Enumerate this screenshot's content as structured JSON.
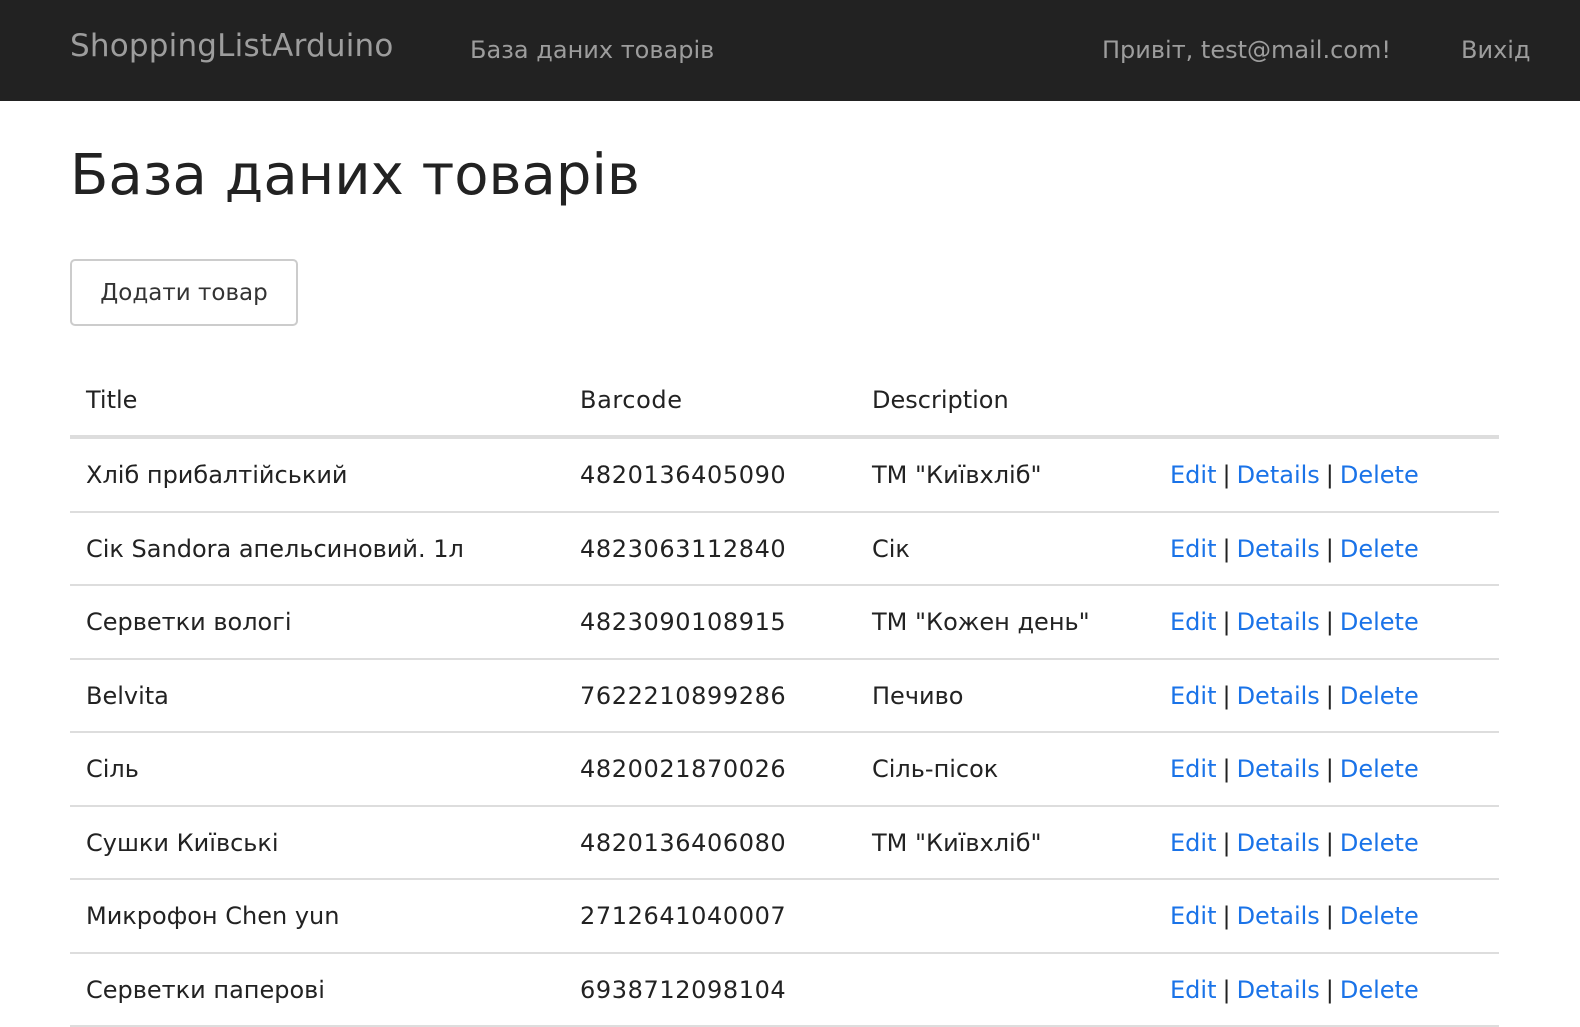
{
  "navbar": {
    "brand": "ShoppingListArduino",
    "db_link": "База даних товарів",
    "greeting": "Привіт, test@mail.com!",
    "logout": "Вихід"
  },
  "main": {
    "title": "База даних товарів",
    "add_button": "Додати товар"
  },
  "table": {
    "headers": {
      "title": "Title",
      "barcode": "Barcode",
      "description": "Description"
    },
    "actions": {
      "edit": "Edit",
      "details": "Details",
      "delete": "Delete",
      "separator": "|"
    },
    "rows": [
      {
        "title": "Хліб прибалтійський",
        "barcode": "4820136405090",
        "description": "ТМ \"Київхліб\""
      },
      {
        "title": "Сік Sandora апельсиновий. 1л",
        "barcode": "4823063112840",
        "description": "Сік"
      },
      {
        "title": "Серветки вологі",
        "barcode": "4823090108915",
        "description": "ТМ \"Кожен день\""
      },
      {
        "title": "Belvita",
        "barcode": "7622210899286",
        "description": "Печиво"
      },
      {
        "title": "Сіль",
        "barcode": "4820021870026",
        "description": "Сіль-пісок"
      },
      {
        "title": "Сушки Київські",
        "barcode": "4820136406080",
        "description": "ТМ \"Київхліб\""
      },
      {
        "title": "Микрофон Chen yun",
        "barcode": "2712641040007",
        "description": ""
      },
      {
        "title": "Серветки паперові",
        "barcode": "6938712098104",
        "description": ""
      }
    ]
  },
  "colors": {
    "navbar_bg": "#222222",
    "navbar_text": "#9d9d9d",
    "link": "#1a73e8",
    "border": "#dddddd"
  }
}
